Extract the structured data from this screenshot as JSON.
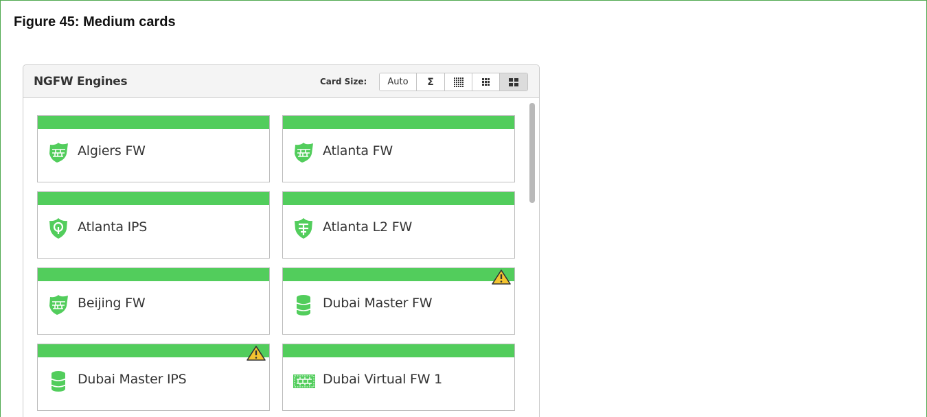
{
  "figure": {
    "title": "Figure 45: Medium cards"
  },
  "panel": {
    "title": "NGFW Engines",
    "card_size_label": "Card Size:",
    "size_options": {
      "auto": "Auto",
      "summary": "Σ",
      "selected": "medium"
    }
  },
  "colors": {
    "status_ok": "#52cd5c",
    "warning": "#f4c430",
    "figure_border": "#4fa84f"
  },
  "cards": [
    {
      "label": "Algiers FW",
      "icon": "firewall-shield-icon",
      "warning": false
    },
    {
      "label": "Atlanta FW",
      "icon": "firewall-shield-icon",
      "warning": false
    },
    {
      "label": "Atlanta IPS",
      "icon": "ips-shield-icon",
      "warning": false
    },
    {
      "label": "Atlanta L2 FW",
      "icon": "l2-firewall-shield-icon",
      "warning": false
    },
    {
      "label": "Beijing FW",
      "icon": "firewall-shield-icon",
      "warning": false
    },
    {
      "label": "Dubai Master FW",
      "icon": "database-icon",
      "warning": true
    },
    {
      "label": "Dubai Master IPS",
      "icon": "database-icon",
      "warning": true
    },
    {
      "label": "Dubai Virtual FW 1",
      "icon": "virtual-firewall-icon",
      "warning": false
    }
  ]
}
